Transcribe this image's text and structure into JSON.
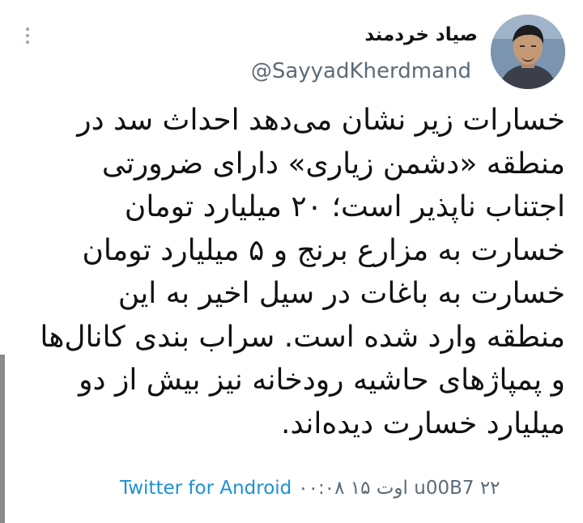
{
  "tweet": {
    "display_name": "صیاد خردمند",
    "handle": "@SayyadKherdmand",
    "text": "خسارات زیر نشان می‌دهد احداث سد در\nمنطقه «دشمن زیاری» دارای ضرورتی\nاجتناب ناپذیر است؛ ۲۰ میلیارد تومان\nخسارت به مزارع برنج و  ۵ میلیارد تومان\nخسارت به  باغات در سیل اخیر به این\nمنطقه وارد شده است. سراب بندی کانال‌ها\nو پمپاژهای حاشیه رودخانه نیز  بیش از دو\nمیلیارد خسارت دیده‌اند.",
    "source": "Twitter for Android",
    "date": "u00B7 ۲۲ اوت ۱۵ ۰۰:۰۸"
  },
  "icons": {
    "more": "more-options-icon",
    "avatar": "profile-photo"
  }
}
